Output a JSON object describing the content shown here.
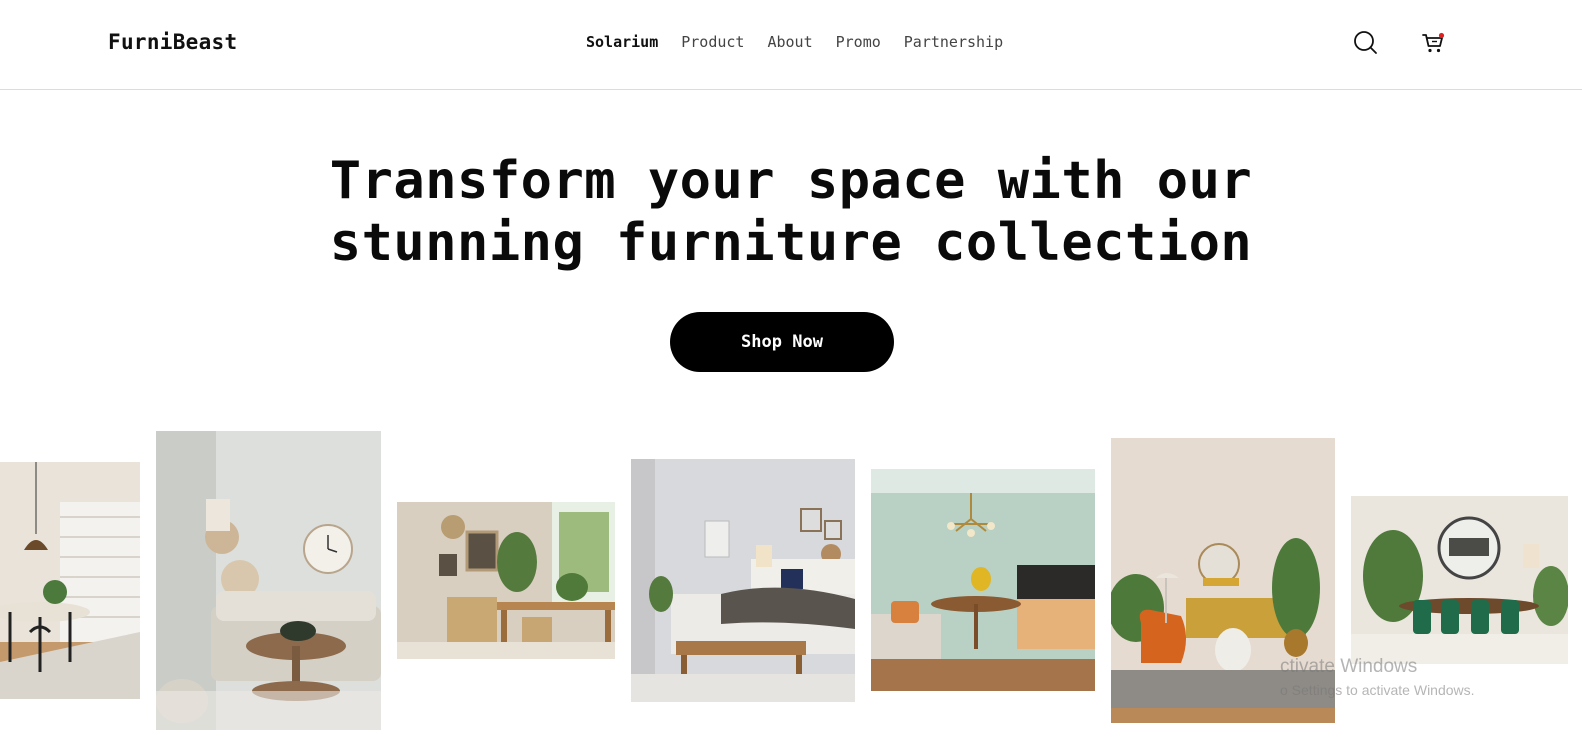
{
  "brand": {
    "name": "FurniBeast"
  },
  "nav": {
    "items": [
      {
        "label": "Solarium",
        "active": true
      },
      {
        "label": "Product",
        "active": false
      },
      {
        "label": "About",
        "active": false
      },
      {
        "label": "Promo",
        "active": false
      },
      {
        "label": "Partnership",
        "active": false
      }
    ]
  },
  "header_icons": {
    "search": "search-icon",
    "cart": "cart-icon",
    "cart_badge_color": "#e02020"
  },
  "hero": {
    "title_line1": "Transform your space with our",
    "title_line2": "stunning furniture collection",
    "cta_label": "Shop Now"
  },
  "gallery": [
    {
      "scene": "dining room with pendant lamp and window blinds"
    },
    {
      "scene": "living room with grey sofa and wall clock"
    },
    {
      "scene": "home office with wooden desk and plants"
    },
    {
      "scene": "bedroom with bench and framed art"
    },
    {
      "scene": "sage green dining nook with chandelier"
    },
    {
      "scene": "living room with orange armchair and round mirror"
    },
    {
      "scene": "dining room with green velvet chairs"
    }
  ],
  "watermark": {
    "title": "ctivate Windows",
    "subtitle": "o Settings to activate Windows."
  },
  "colors": {
    "accent": "#000000",
    "background": "#ffffff"
  }
}
